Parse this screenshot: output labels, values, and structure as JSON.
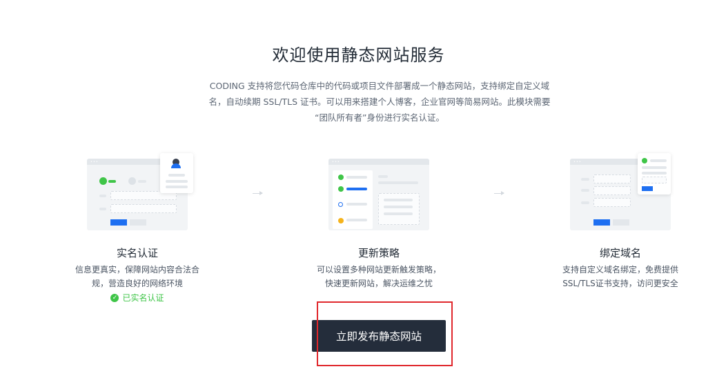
{
  "header": {
    "title": "欢迎使用静态网站服务",
    "description_lines": [
      "CODING 支持将您代码仓库中的代码或项目文件部署成一个静态网站，支持绑定自定义域",
      "名，自动续期 SSL/TLS 证书。可以用来搭建个人博客，企业官网等简易网站。此模块需要",
      "“团队所有者”身份进行实名认证。"
    ]
  },
  "features": [
    {
      "title": "实名认证",
      "desc_lines": [
        "信息更真实，保障网站内容合法合",
        "规，营造良好的网络环境"
      ],
      "status": "已实名认证"
    },
    {
      "title": "更新策略",
      "desc_lines": [
        "可以设置多种网站更新触发策略，",
        "快速更新网站，解决运维之忧"
      ]
    },
    {
      "title": "绑定域名",
      "desc_lines": [
        "支持自定义域名绑定，免费提供",
        "SSL/TLS证书支持，访问更安全"
      ]
    }
  ],
  "actions": {
    "publish_label": "立即发布静态网站"
  },
  "icons": {
    "verified": "check-circle-icon",
    "arrow": "arrow-right-icon"
  },
  "colors": {
    "primary": "#1e6ff1",
    "success": "#3fc548",
    "button_bg": "#242d3b",
    "annotation": "#e0272c"
  }
}
